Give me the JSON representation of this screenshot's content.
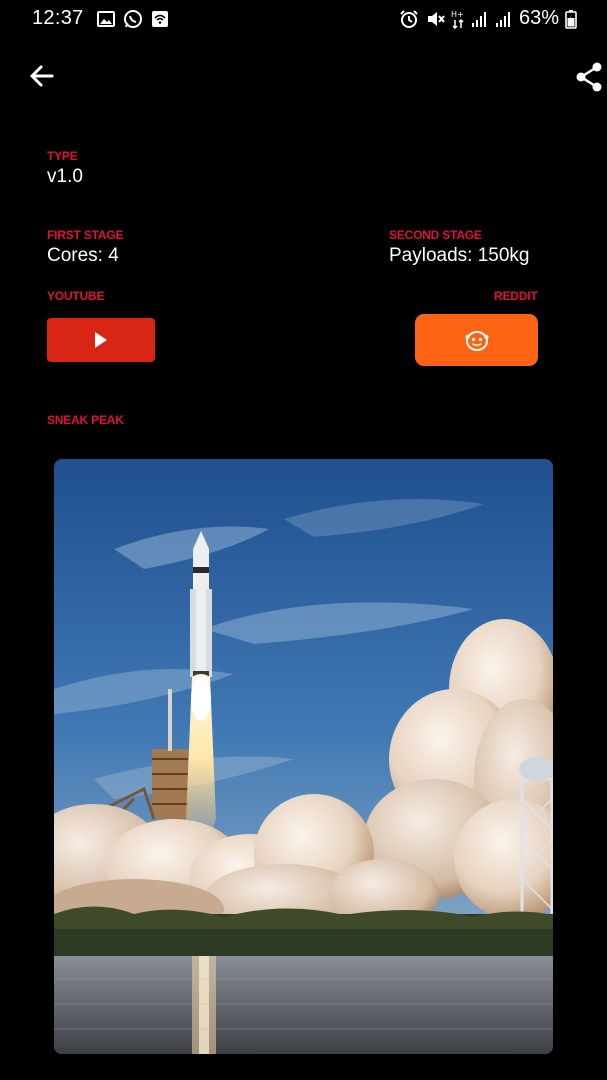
{
  "status_bar": {
    "time": "12:37",
    "battery_text": "63%",
    "left_icons": [
      "gallery-icon",
      "whatsapp-icon",
      "wifi-calling-icon"
    ],
    "right_icons": [
      "alarm-icon",
      "mute-icon",
      "data-arrows-icon",
      "signal-icon",
      "signal-icon",
      "battery-icon"
    ]
  },
  "app_bar": {
    "back_icon": "arrow-left-icon",
    "share_icon": "share-icon"
  },
  "details": {
    "type_label": "TYPE",
    "type_value": "v1.0",
    "first_stage_label": "FIRST STAGE",
    "first_stage_value": "Cores: 4",
    "second_stage_label": "SECOND STAGE",
    "second_stage_value": "Payloads: 150kg",
    "youtube_label": "YOUTUBE",
    "reddit_label": "REDDIT",
    "sneak_peak_label": "SNEAK PEAK"
  },
  "colors": {
    "label_red": "#e0103a",
    "youtube_red": "#d92614",
    "reddit_orange": "#ff6314",
    "background": "#000000"
  },
  "image": {
    "content": "rocket launch photo"
  }
}
